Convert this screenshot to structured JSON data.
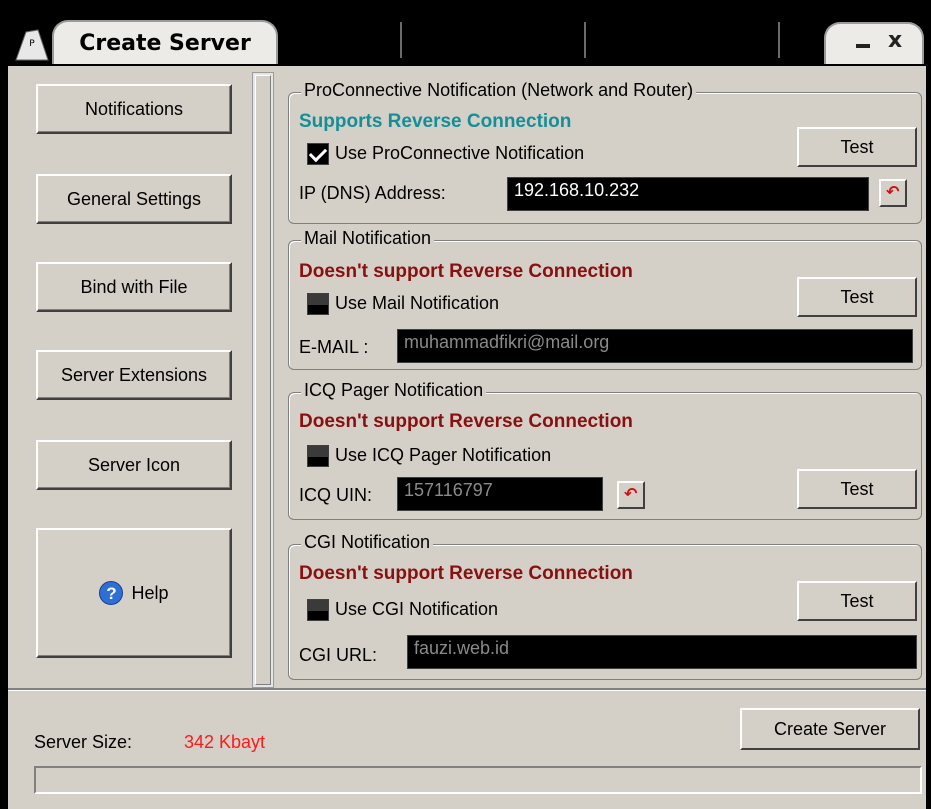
{
  "window": {
    "title": "Create Server",
    "minimize": "_",
    "close": "x"
  },
  "nav": {
    "notifications": "Notifications",
    "general_settings": "General Settings",
    "bind_with_file": "Bind with File",
    "server_extensions": "Server Extensions",
    "server_icon": "Server Icon",
    "help": "Help",
    "help_icon_glyph": "?"
  },
  "groups": {
    "proconnective": {
      "legend": "ProConnective Notification (Network and Router)",
      "status": "Supports Reverse Connection",
      "checkbox_label": "Use ProConnective Notification",
      "checked": true,
      "field_label": "IP (DNS) Address:",
      "field_value": "192.168.10.232",
      "test": "Test"
    },
    "mail": {
      "legend": "Mail Notification",
      "status": "Doesn't support Reverse Connection",
      "checkbox_label": "Use Mail Notification",
      "checked": false,
      "field_label": "E-MAIL :",
      "field_value": "muhammadfikri@mail.org",
      "test": "Test"
    },
    "icq": {
      "legend": "ICQ Pager Notification",
      "status": "Doesn't support Reverse Connection",
      "checkbox_label": "Use ICQ Pager Notification",
      "checked": false,
      "field_label": "ICQ UIN:",
      "field_value": "157116797",
      "test": "Test"
    },
    "cgi": {
      "legend": "CGI Notification",
      "status": "Doesn't support Reverse Connection",
      "checkbox_label": "Use CGI Notification",
      "checked": false,
      "field_label": "CGI URL:",
      "field_value": "fauzi.web.id",
      "test": "Test"
    }
  },
  "footer": {
    "server_size_label": "Server Size:",
    "server_size_value": "342 Kbayt",
    "create_button": "Create Server",
    "progress": 0
  },
  "colors": {
    "supports": "#148f98",
    "unsupported": "#8a0f0f",
    "size_value": "#ff1a1a",
    "face": "#d4d0c8"
  },
  "icons": [
    "app-logo-icon",
    "minimize-icon",
    "close-icon",
    "help-icon",
    "reset-icon",
    "check-icon"
  ]
}
